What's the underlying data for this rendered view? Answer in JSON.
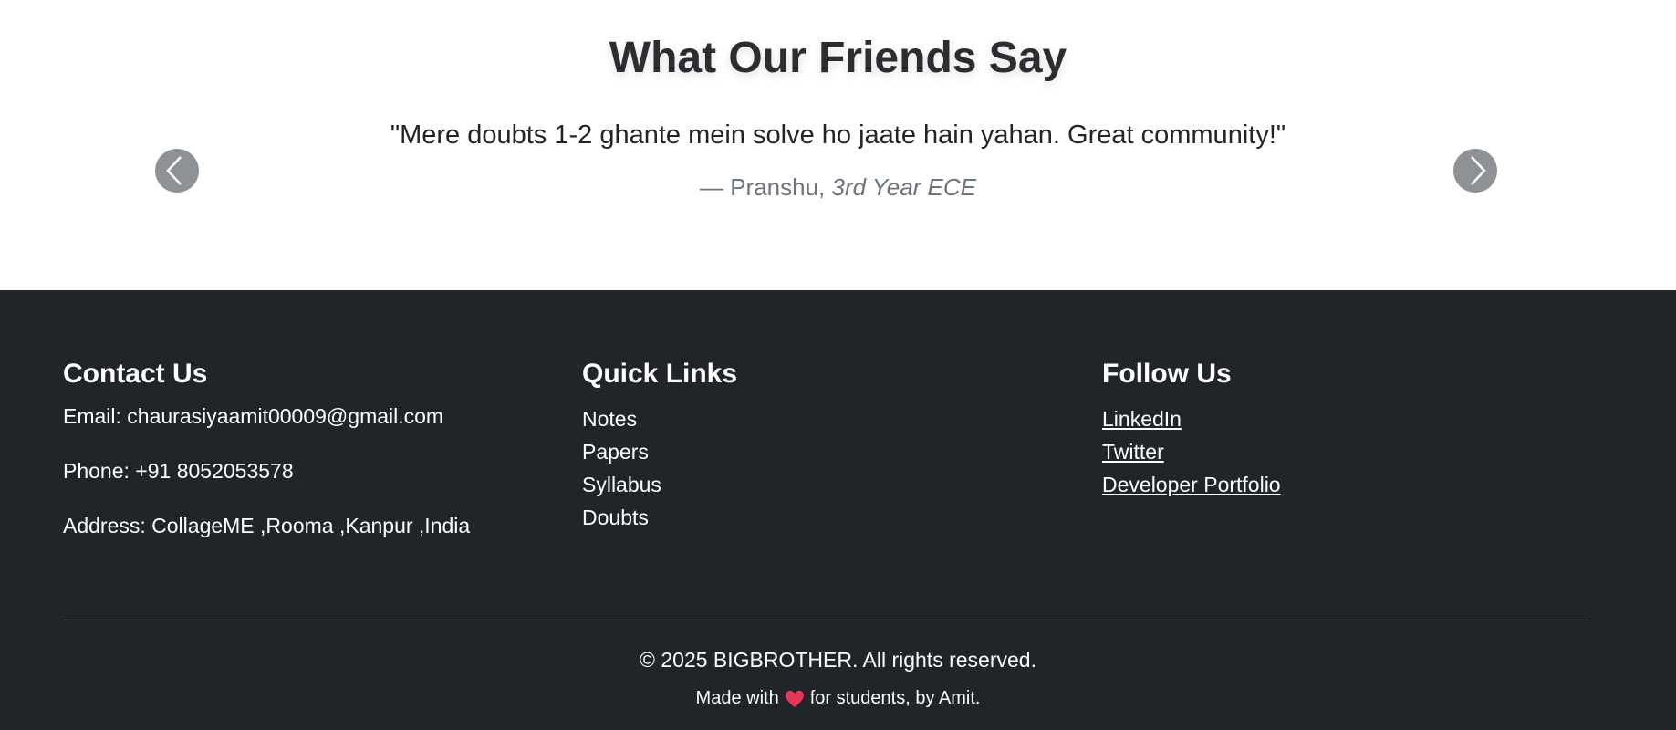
{
  "testimonials": {
    "title": "What Our Friends Say",
    "quote": "\"Mere doubts 1-2 ghante mein solve ho jaate hain yahan. Great community!\"",
    "author_prefix": "— Pranshu, ",
    "author_role": "3rd Year ECE",
    "prev_icon": "chevron-left-icon",
    "next_icon": "chevron-right-icon"
  },
  "footer": {
    "contact": {
      "heading": "Contact Us",
      "email": "Email: chaurasiyaamit00009@gmail.com",
      "phone": "Phone: +91 8052053578",
      "address": "Address: CollageME ,Rooma ,Kanpur ,India"
    },
    "quick_links": {
      "heading": "Quick Links",
      "items": [
        "Notes",
        "Papers",
        "Syllabus",
        "Doubts"
      ]
    },
    "follow": {
      "heading": "Follow Us",
      "items": [
        "LinkedIn",
        "Twitter",
        "Developer Portfolio"
      ]
    },
    "copyright": "© 2025 BIGBROTHER. All rights reserved.",
    "made_with_prefix": "Made with",
    "made_with_suffix": "for students, by Amit.",
    "heart_color": "#e8365a"
  },
  "colors": {
    "footer_bg": "#212529",
    "carousel_button": "#8e9195"
  }
}
